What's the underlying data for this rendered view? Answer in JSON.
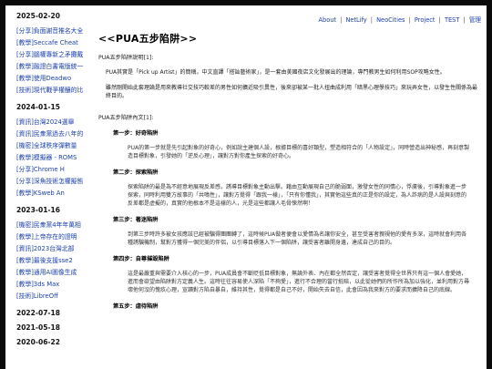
{
  "sidebar": [
    {
      "date": "2025-02-20",
      "links": [
        {
          "tag": "[分享]",
          "title": "負面謝音推名大全"
        },
        {
          "tag": "[教學]",
          "title": "Seccafe Cheat"
        },
        {
          "tag": "[分享]",
          "title": "腦權專新之矛攤戴"
        },
        {
          "tag": "[教學]",
          "title": "融證白書電版統一"
        },
        {
          "tag": "[教學]",
          "title": "使用Deadwo"
        },
        {
          "tag": "[技術]",
          "title": "現代戰爭權釀的比"
        }
      ]
    },
    {
      "date": "2024-01-15",
      "links": [
        {
          "tag": "[資訊]",
          "title": "台灣2024選舉"
        },
        {
          "tag": "[資訊]",
          "title": "民衆黨過去八年的"
        },
        {
          "tag": "[機密]",
          "title": "全球秩序彈數量"
        },
        {
          "tag": "[教學]",
          "title": "模擬器 - ROMS"
        },
        {
          "tag": "[分享]",
          "title": "Chrome H"
        },
        {
          "tag": "[分享]",
          "title": "深魚技術怎權擬態"
        },
        {
          "tag": "[教學]",
          "title": "KSweb An"
        }
      ]
    },
    {
      "date": "2023-01-16",
      "links": [
        {
          "tag": "[機密]",
          "title": "民衆黨4年年萬相"
        },
        {
          "tag": "[教學]",
          "title": "上帝存在的證明"
        },
        {
          "tag": "[資訊]",
          "title": "2023台灣北部"
        },
        {
          "tag": "[教學]",
          "title": "最後支援sse2"
        },
        {
          "tag": "[教學]",
          "title": "通用AI圖像生成"
        },
        {
          "tag": "[教學]",
          "title": "3ds Max"
        },
        {
          "tag": "[技術]",
          "title": "LibreOff"
        }
      ]
    },
    {
      "date": "2022-07-18",
      "links": []
    },
    {
      "date": "2021-05-18",
      "links": []
    },
    {
      "date": "2020-06-22",
      "links": []
    }
  ],
  "topnav": {
    "about": "About",
    "netlify": "NetLify",
    "neocities": "NeoCities",
    "project": "Project",
    "test": "TEST",
    "admin": "管理",
    "separator": "|"
  },
  "article": {
    "title": "<<PUA五步陷阱>>",
    "intro_heading": "PUA五步陷阱說明[1]:",
    "para1": "PUA其實是「Pick up Artist」的簡稱，中文直譯「搭訕藝術家」，是一套由美國夜店文化發展出的理論，專門教男生如何利用SOP攻略女性。",
    "para2": "雖然剛開始此套理論是用來教導社交技巧較差的男性如何擴近吸引異性，後來卻被某一批人扭曲成利用「暗黑心理學技巧」來玩弄女性，以發生性關係為最終目的。",
    "five_steps_heading": "PUA五步陷阱內文[1]:",
    "steps": [
      {
        "title": "第一步：好奇陷阱",
        "body": "PUA的第一步就是先引起對象的好奇心，例如說主建個人設，根據目標的喜好類型，塑造相符合的「人物設定」，同時營造出神秘感，再刻意製造目標對象，引發她的「逆反心理」，讓對方對你產生探索的好奇心。"
      },
      {
        "title": "第二步：探索陷阱",
        "body": "探索陷阱的最是為不經意地展現反差感，誘導目標對象主動出擊。藉由互動展現自己的脆弱面，激發女性的同情心，俘虜後，引導對象進一步探索，同時利用雙方故事的「共鳴性」，讓對方覺得「跟我一樣」，「只有你懂我」，其實他這些真的正是你的設定，為人詐病的是人設與刻意的反差都是虛擬的，真實的他根本不是這樣的人，光是這些都讓人毛骨悚然啊！"
      },
      {
        "title": "第三步：著迷陷阱",
        "body": "到第三步時許多被女孩應該已經被騙得團團轉了，這時候PUA做者便會以愛情為名讓你安全，甚至受害者親視他的愛有多深，這時就會利用各種誘騙機制，幫對方獲得一個完美的伴侶，以引導目標落入下一個陷阱，讓受害者離開身邊，達成自己的目的。"
      },
      {
        "title": "第四步：自尊摧毀陷阱",
        "body": "這是最嚴重與需要介入核心的一步，PUA成員會不斷貶低目標對象，無論外表、內在都全然否定，讓受害者覺得全世界只有這一個人會愛她，進而會欲望由陷阱對方定義人生。這時往往容易使人深陷「不夠愛」，進行不合理的當行抵賠，以此從她們的所作所為加以強化，並利用對方尋壞他何沒的愧疚心理，宣讀對方陷自暴自，維持其性，覺得都是自己不好，開始失去自信，此會因為我來對方的要求而擴降自己的底線。"
      },
      {
        "title": "第五步：虐待陷阱",
        "body": ""
      }
    ]
  }
}
